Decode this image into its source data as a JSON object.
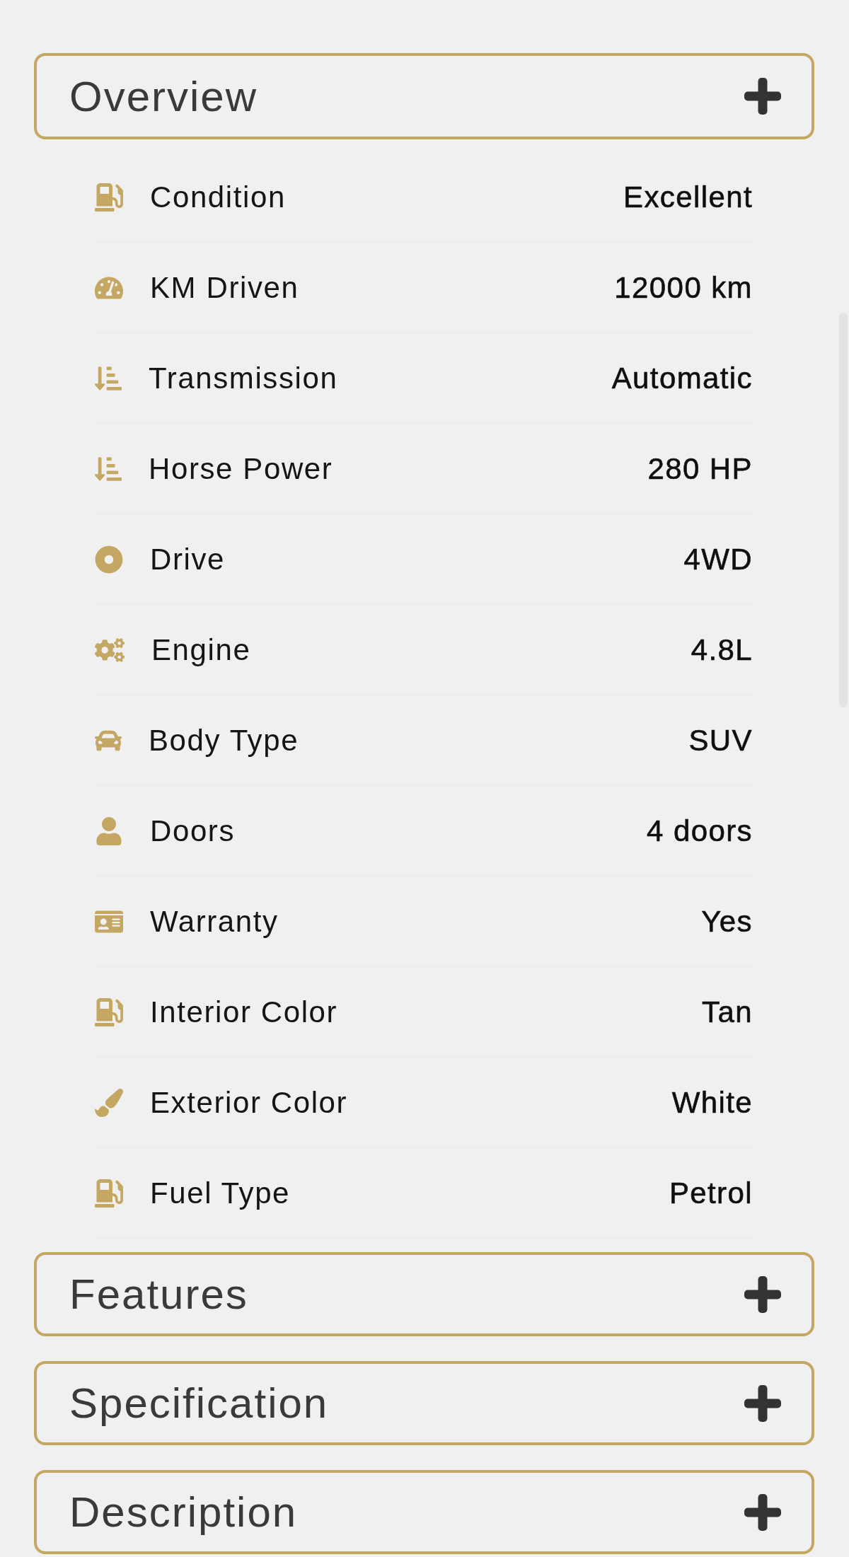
{
  "sections": [
    {
      "title": "Overview",
      "rows": [
        {
          "label": "Condition",
          "value": "Excellent"
        },
        {
          "label": "KM Driven",
          "value": "12000 km"
        },
        {
          "label": "Transmission",
          "value": "Automatic"
        },
        {
          "label": "Horse Power",
          "value": "280 HP"
        },
        {
          "label": "Drive",
          "value": "4WD"
        },
        {
          "label": "Engine",
          "value": "4.8L"
        },
        {
          "label": "Body Type",
          "value": "SUV"
        },
        {
          "label": "Doors",
          "value": "4 doors"
        },
        {
          "label": "Warranty",
          "value": "Yes"
        },
        {
          "label": "Interior Color",
          "value": "Tan"
        },
        {
          "label": "Exterior Color",
          "value": "White"
        },
        {
          "label": "Fuel Type",
          "value": "Petrol"
        }
      ]
    },
    {
      "title": "Features"
    },
    {
      "title": "Specification"
    },
    {
      "title": "Description"
    }
  ]
}
